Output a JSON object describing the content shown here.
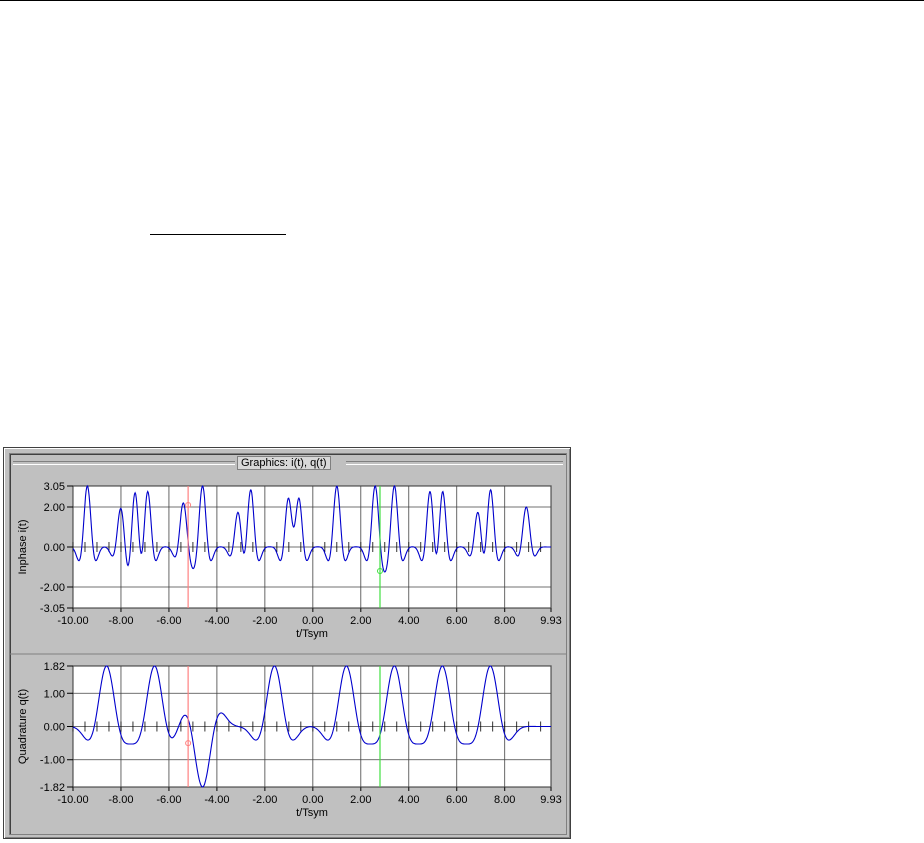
{
  "panel": {
    "title": "Graphics: i(t), q(t)"
  },
  "chart_data": [
    {
      "type": "line",
      "ylabel": "Inphase i(t)",
      "xlabel": "t/Tsym",
      "xlim": [
        -10.0,
        9.93
      ],
      "ylim": [
        -3.05,
        3.05
      ],
      "x_ticks": [
        "-10.00",
        "-8.00",
        "-6.00",
        "-4.00",
        "-2.00",
        "0.00",
        "2.00",
        "4.00",
        "6.00",
        "8.00",
        "9.93"
      ],
      "y_ticks": [
        "3.05",
        "2.00",
        "0.00",
        "-2.00",
        "-3.05"
      ],
      "grid": true,
      "cursors": [
        {
          "x": -5.2,
          "y": 2.1,
          "color": "#ff8080"
        },
        {
          "x": 2.8,
          "y": -1.2,
          "color": "#40e040"
        }
      ],
      "series": [
        {
          "color": "#0000cc",
          "peaks": [
            {
              "x": -9.4,
              "y": 3.05
            },
            {
              "x": -8.0,
              "y": 2.0
            },
            {
              "x": -7.4,
              "y": 3.05
            },
            {
              "x": -6.9,
              "y": 3.05
            },
            {
              "x": -5.4,
              "y": 2.2
            },
            {
              "x": -4.6,
              "y": 3.05
            },
            {
              "x": -3.1,
              "y": 2.0
            },
            {
              "x": -2.6,
              "y": 3.05
            },
            {
              "x": -1.0,
              "y": 3.05
            },
            {
              "x": -0.6,
              "y": 3.05
            },
            {
              "x": 1.0,
              "y": 3.05
            },
            {
              "x": 2.6,
              "y": 3.05
            },
            {
              "x": 3.4,
              "y": 3.05
            },
            {
              "x": 4.9,
              "y": 3.05
            },
            {
              "x": 5.4,
              "y": 3.05
            },
            {
              "x": 6.9,
              "y": 2.0
            },
            {
              "x": 7.4,
              "y": 3.05
            },
            {
              "x": 8.9,
              "y": 2.0
            }
          ]
        }
      ]
    },
    {
      "type": "line",
      "ylabel": "Quadrature q(t)",
      "xlabel": "t/Tsym",
      "xlim": [
        -10.0,
        9.93
      ],
      "ylim": [
        -1.82,
        1.82
      ],
      "x_ticks": [
        "-10.00",
        "-8.00",
        "-6.00",
        "-4.00",
        "-2.00",
        "0.00",
        "2.00",
        "4.00",
        "6.00",
        "8.00",
        "9.93"
      ],
      "y_ticks": [
        "1.82",
        "1.00",
        "0.00",
        "-1.00",
        "-1.82"
      ],
      "grid": true,
      "cursors": [
        {
          "x": -5.2,
          "y": -0.5,
          "color": "#ff8080"
        },
        {
          "x": 2.8,
          "color": "#40e040"
        }
      ],
      "series": [
        {
          "color": "#0000cc",
          "peaks": [
            {
              "x": -8.6,
              "y": 1.82
            },
            {
              "x": -6.6,
              "y": 1.82
            },
            {
              "x": -4.6,
              "y": -1.82
            },
            {
              "x": -1.6,
              "y": 1.82
            },
            {
              "x": 1.4,
              "y": 1.82
            },
            {
              "x": 3.4,
              "y": 1.82
            },
            {
              "x": 5.4,
              "y": 1.82
            },
            {
              "x": 7.4,
              "y": 1.82
            }
          ]
        }
      ]
    }
  ]
}
